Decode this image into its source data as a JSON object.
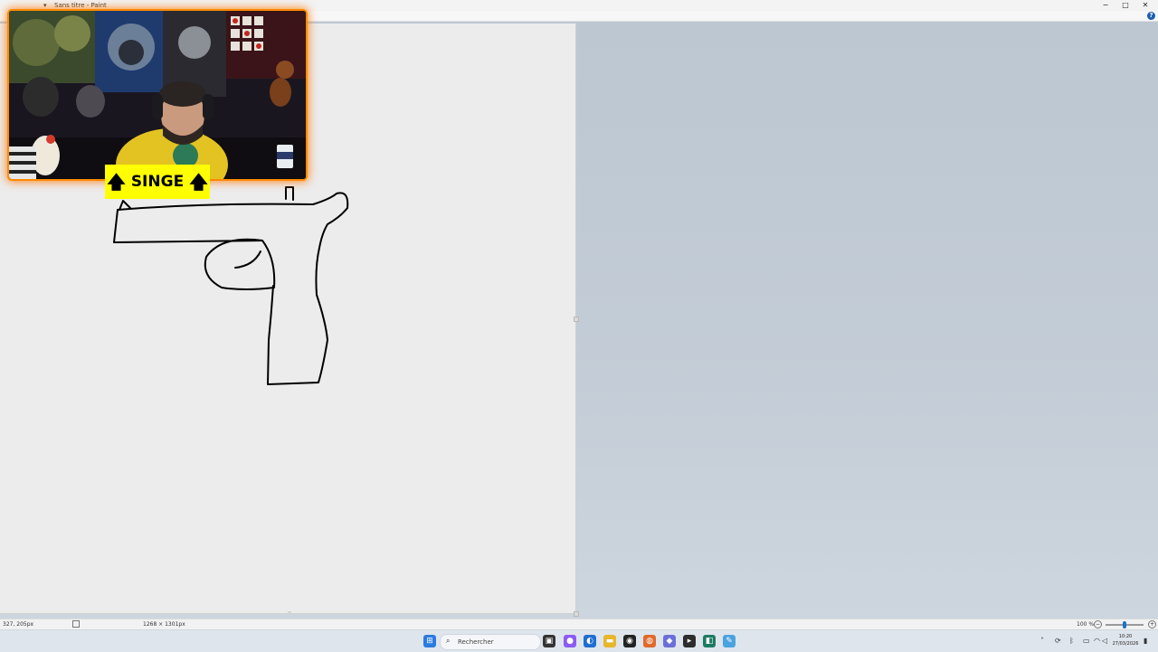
{
  "window": {
    "title": "Sans titre - Paint",
    "app_icon": "paint-icon",
    "controls": {
      "minimize": "−",
      "maximize": "□",
      "close": "✕"
    },
    "help_label": "?"
  },
  "overlay": {
    "label": "SINGE",
    "arrow_left": "🡅",
    "arrow_right": "🡅",
    "label_bg": "#ffff00",
    "frame_glow": "#ff8a00"
  },
  "statusbar": {
    "cursor_position": "327, 205px",
    "canvas_size": "1268 × 1301px",
    "zoom": "100 %",
    "zoom_minus": "−",
    "zoom_plus": "+"
  },
  "taskbar": {
    "search_placeholder": "Rechercher",
    "clock_time": "10:20",
    "clock_date": "27/03/2026",
    "icons": [
      "windows-start-icon",
      "task-view-icon",
      "copilot-icon",
      "edge-icon",
      "file-explorer-icon",
      "obs-icon",
      "firefox-icon",
      "app-icon",
      "terminal-icon",
      "vscode-icon",
      "paint-icon"
    ],
    "tray_icons": [
      "chevron-up-icon",
      "network-icon",
      "bluetooth-icon",
      "monitor-icon",
      "wifi-icon",
      "volume-icon",
      "notification-icon"
    ]
  }
}
